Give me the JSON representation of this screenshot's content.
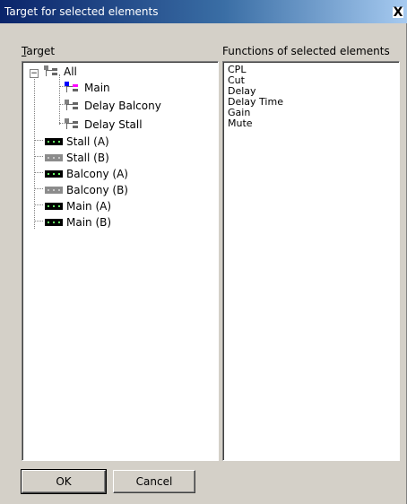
{
  "window": {
    "title": "Target for selected elements",
    "close_label": "X"
  },
  "target_label_prefix": "T",
  "target_label_rest": "arget",
  "functions_label": "Functions of selected elements",
  "tree": {
    "root": {
      "label": "All",
      "icon": "group-icon",
      "expander": "−"
    },
    "children": [
      {
        "label": "Main",
        "icon": "group-icon-selected"
      },
      {
        "label": "Delay Balcony",
        "icon": "group-icon"
      },
      {
        "label": "Delay Stall",
        "icon": "group-icon"
      }
    ],
    "devices": [
      {
        "label": "Stall (A)",
        "icon": "device-active-icon"
      },
      {
        "label": "Stall (B)",
        "icon": "device-inactive-icon"
      },
      {
        "label": "Balcony (A)",
        "icon": "device-active-icon"
      },
      {
        "label": "Balcony (B)",
        "icon": "device-inactive-icon"
      },
      {
        "label": "Main (A)",
        "icon": "device-active-icon"
      },
      {
        "label": "Main (B)",
        "icon": "device-active-icon"
      }
    ]
  },
  "functions": [
    "CPL",
    "Cut",
    "Delay",
    "Delay Time",
    "Gain",
    "Mute"
  ],
  "buttons": {
    "ok": "OK",
    "cancel": "Cancel"
  },
  "colors": {
    "title_bar_start": "#0a246a",
    "title_bar_end": "#a6caf0",
    "dialog_bg": "#d4d0c8",
    "selected_group_accent_1": "#0000ff",
    "selected_group_accent_2": "#ff00ff"
  }
}
